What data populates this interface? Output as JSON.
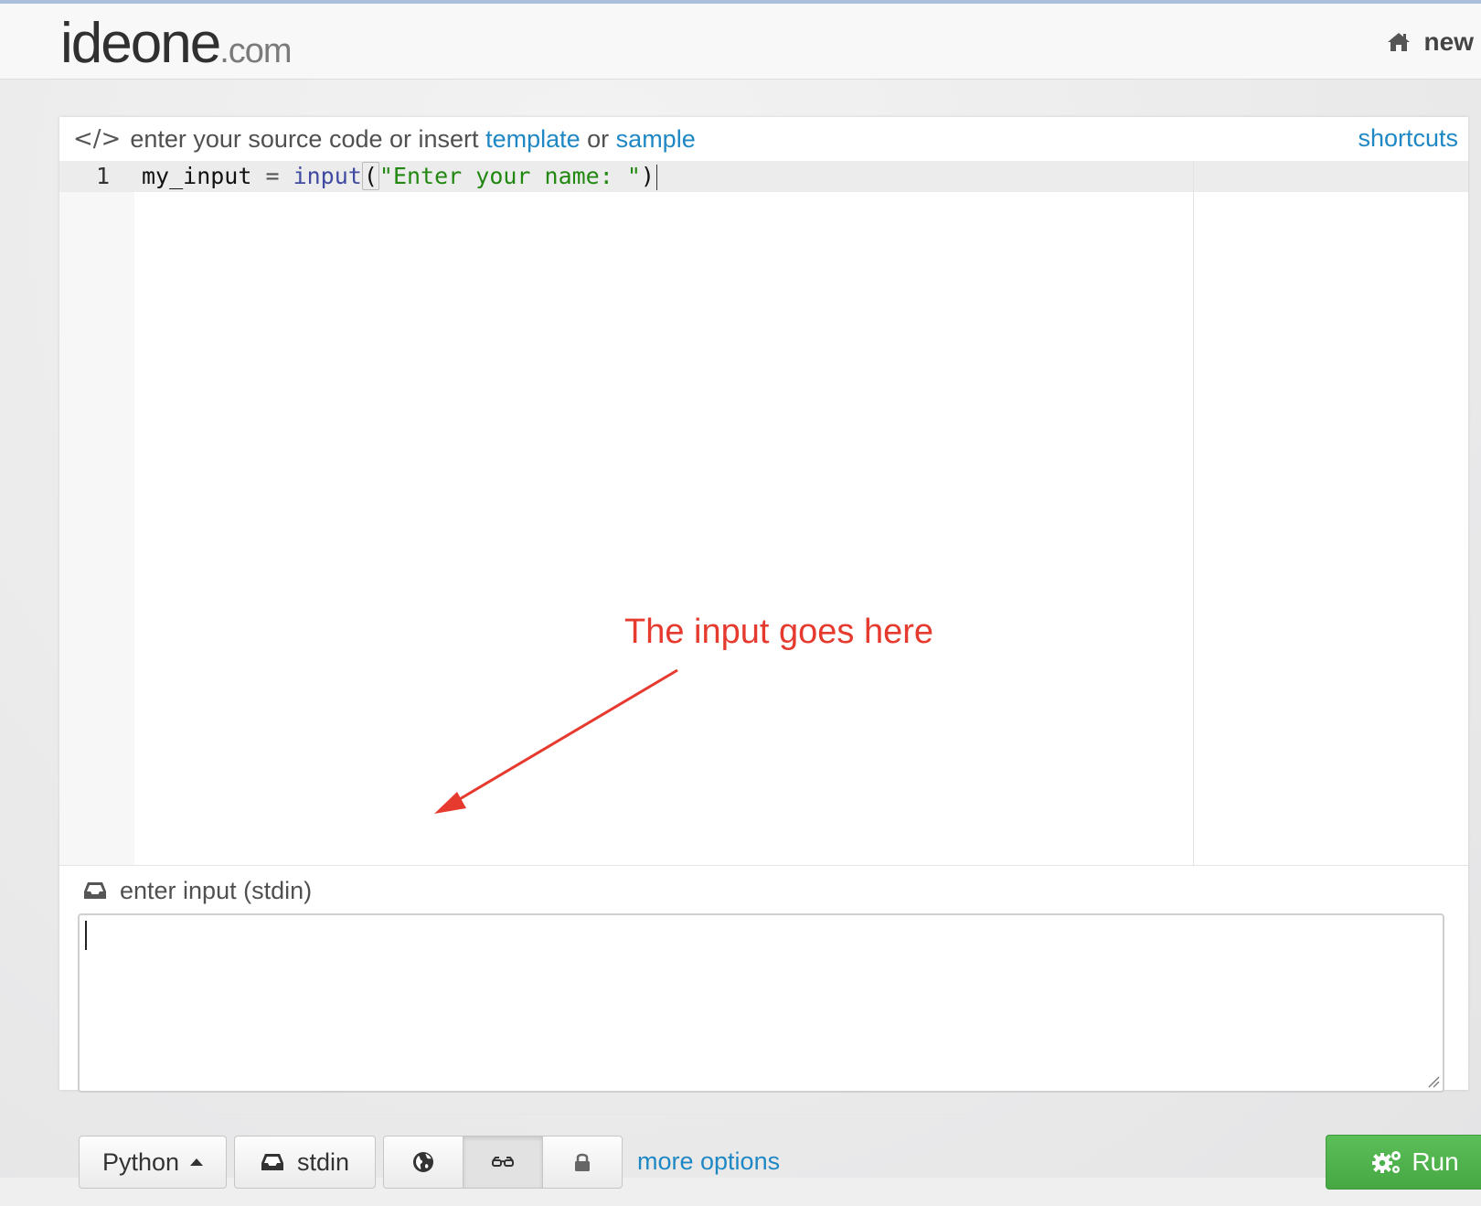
{
  "header": {
    "logo_main": "ideone",
    "logo_suffix": ".com",
    "nav_new_label": "new"
  },
  "source": {
    "prefix_text": "enter your source code or insert",
    "template_link": "template",
    "or_text": "or",
    "sample_link": "sample",
    "shortcuts_link": "shortcuts"
  },
  "editor": {
    "line_number": "1",
    "code": {
      "var": "my_input",
      "op": " = ",
      "fn": "input",
      "open_paren": "(",
      "string": "\"Enter your name: \"",
      "close_paren": ")"
    }
  },
  "annotation": {
    "text": "The input goes here",
    "color": "#e63a2f"
  },
  "stdin": {
    "label": "enter input (stdin)",
    "value": ""
  },
  "toolbar": {
    "language_label": "Python",
    "stdin_label": "stdin",
    "visibility_options": [
      "public-globe-icon",
      "secret-glasses-icon",
      "private-lock-icon"
    ],
    "selected_visibility": "secret-glasses-icon",
    "more_options_label": "more options",
    "run_label": "Run"
  },
  "colors": {
    "link": "#1f88c4",
    "run_button": "#4caf50",
    "string": "#228811",
    "function": "#3f4aa0"
  }
}
